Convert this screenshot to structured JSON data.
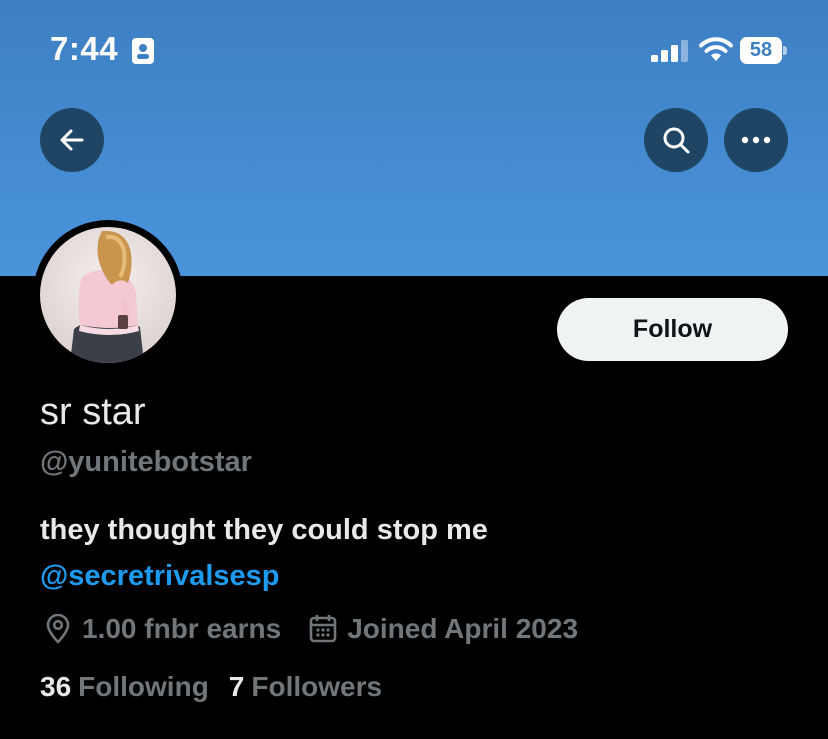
{
  "status_bar": {
    "time": "7:44",
    "battery_level": "58",
    "battery_fraction": 0.58
  },
  "header": {
    "icons": [
      "back-arrow-icon",
      "search-icon",
      "more-icon"
    ]
  },
  "profile": {
    "display_name": "sr star",
    "handle": "@yunitebotstar",
    "follow_label": "Follow",
    "bio": "they thought they could stop me",
    "bio_mention": "@secretrivalsesp",
    "location": "1.00 fnbr earns",
    "joined": "Joined April 2023",
    "following_count": "36",
    "following_label": "Following",
    "followers_count": "7",
    "followers_label": "Followers"
  },
  "colors": {
    "banner": "#4a94dc",
    "link": "#1d9bf0",
    "secondary_text": "#71767b",
    "primary_text": "#e7e9ea"
  }
}
